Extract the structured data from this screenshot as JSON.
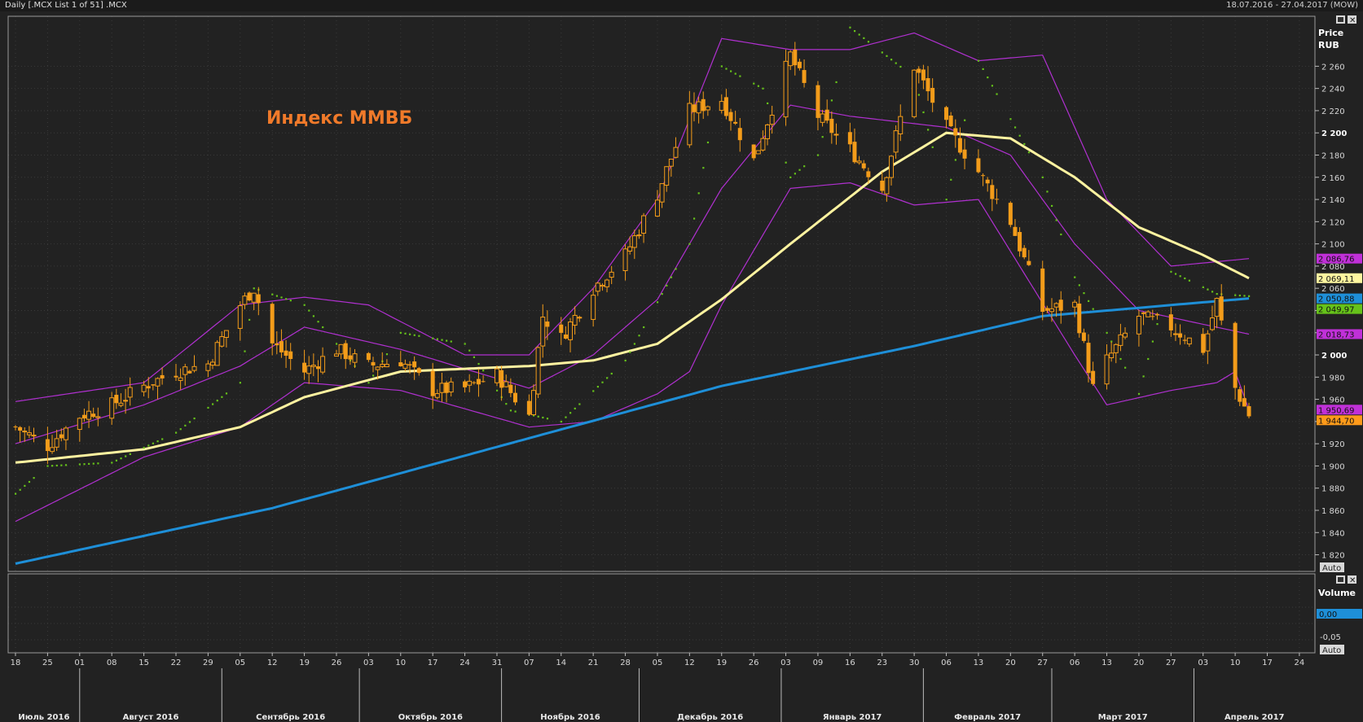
{
  "window": {
    "title": "Daily [.MCX List 1 of 51] .MCX",
    "date_range": "18.07.2016 - 27.04.2017 (MOW)",
    "auto_label": "Auto"
  },
  "price_panel": {
    "axis_title_1": "Price",
    "axis_title_2": "RUB"
  },
  "volume_panel": {
    "title": "Volume",
    "value_tag": "0,00",
    "tick": "-0,05"
  },
  "chart_data": {
    "type": "candlestick",
    "title": "Индекс ММВБ",
    "ylim": [
      1805,
      2305
    ],
    "y_ticks": [
      {
        "label": "1 820",
        "bold": false
      },
      {
        "label": "1 840",
        "bold": false
      },
      {
        "label": "1 860",
        "bold": false
      },
      {
        "label": "1 880",
        "bold": false
      },
      {
        "label": "1 900",
        "bold": false
      },
      {
        "label": "1 920",
        "bold": false
      },
      {
        "label": "1 940",
        "bold": false
      },
      {
        "label": "1 960",
        "bold": false
      },
      {
        "label": "1 980",
        "bold": false
      },
      {
        "label": "2 000",
        "bold": true
      },
      {
        "label": "2 020",
        "bold": false
      },
      {
        "label": "2 040",
        "bold": false
      },
      {
        "label": "2 060",
        "bold": false
      },
      {
        "label": "2 080",
        "bold": false
      },
      {
        "label": "2 100",
        "bold": false
      },
      {
        "label": "2 120",
        "bold": false
      },
      {
        "label": "2 140",
        "bold": false
      },
      {
        "label": "2 160",
        "bold": false
      },
      {
        "label": "2 180",
        "bold": false
      },
      {
        "label": "2 200",
        "bold": true
      },
      {
        "label": "2 220",
        "bold": false
      },
      {
        "label": "2 240",
        "bold": false
      },
      {
        "label": "2 260",
        "bold": false
      }
    ],
    "x_day_labels": [
      "18",
      "25",
      "01",
      "08",
      "15",
      "22",
      "29",
      "05",
      "12",
      "19",
      "26",
      "03",
      "10",
      "17",
      "24",
      "31",
      "07",
      "14",
      "21",
      "28",
      "05",
      "12",
      "19",
      "26",
      "03",
      "09",
      "16",
      "23",
      "30",
      "06",
      "13",
      "20",
      "27",
      "06",
      "13",
      "20",
      "27",
      "03",
      "10",
      "17",
      "24"
    ],
    "x_month_labels": [
      "Июль 2016",
      "Август 2016",
      "Сентябрь 2016",
      "Октябрь 2016",
      "Ноябрь 2016",
      "Декабрь 2016",
      "Январь 2017",
      "Февраль 2017",
      "Март 2017",
      "Апрель 2017"
    ],
    "close_keypoints": [
      {
        "date": "2016-07-18",
        "close": 1935
      },
      {
        "date": "2016-07-25",
        "close": 1918
      },
      {
        "date": "2016-08-01",
        "close": 1945
      },
      {
        "date": "2016-08-08",
        "close": 1955
      },
      {
        "date": "2016-08-15",
        "close": 1972
      },
      {
        "date": "2016-08-22",
        "close": 1985
      },
      {
        "date": "2016-08-29",
        "close": 1992
      },
      {
        "date": "2016-09-05",
        "close": 2045
      },
      {
        "date": "2016-09-08",
        "close": 2060
      },
      {
        "date": "2016-09-12",
        "close": 2010
      },
      {
        "date": "2016-09-19",
        "close": 1985
      },
      {
        "date": "2016-09-26",
        "close": 2005
      },
      {
        "date": "2016-10-03",
        "close": 1990
      },
      {
        "date": "2016-10-10",
        "close": 1995
      },
      {
        "date": "2016-10-17",
        "close": 1968
      },
      {
        "date": "2016-10-24",
        "close": 1970
      },
      {
        "date": "2016-10-31",
        "close": 1982
      },
      {
        "date": "2016-11-07",
        "close": 1945
      },
      {
        "date": "2016-11-10",
        "close": 2035
      },
      {
        "date": "2016-11-14",
        "close": 2015
      },
      {
        "date": "2016-11-21",
        "close": 2060
      },
      {
        "date": "2016-11-28",
        "close": 2090
      },
      {
        "date": "2016-12-05",
        "close": 2145
      },
      {
        "date": "2016-12-12",
        "close": 2220
      },
      {
        "date": "2016-12-19",
        "close": 2230
      },
      {
        "date": "2016-12-26",
        "close": 2175
      },
      {
        "date": "2017-01-03",
        "close": 2270
      },
      {
        "date": "2017-01-09",
        "close": 2215
      },
      {
        "date": "2017-01-16",
        "close": 2185
      },
      {
        "date": "2017-01-23",
        "close": 2150
      },
      {
        "date": "2017-01-30",
        "close": 2260
      },
      {
        "date": "2017-02-06",
        "close": 2205
      },
      {
        "date": "2017-02-13",
        "close": 2165
      },
      {
        "date": "2017-02-20",
        "close": 2120
      },
      {
        "date": "2017-02-27",
        "close": 2040
      },
      {
        "date": "2017-03-06",
        "close": 2045
      },
      {
        "date": "2017-03-10",
        "close": 1970
      },
      {
        "date": "2017-03-13",
        "close": 1995
      },
      {
        "date": "2017-03-20",
        "close": 2035
      },
      {
        "date": "2017-03-27",
        "close": 2025
      },
      {
        "date": "2017-04-03",
        "close": 2005
      },
      {
        "date": "2017-04-06",
        "close": 2048
      },
      {
        "date": "2017-04-10",
        "close": 1970
      },
      {
        "date": "2017-04-13",
        "close": 1945
      }
    ],
    "sma_yellow": [
      {
        "date": "2016-07-18",
        "value": 1903
      },
      {
        "date": "2016-08-15",
        "value": 1915
      },
      {
        "date": "2016-09-05",
        "value": 1935
      },
      {
        "date": "2016-09-19",
        "value": 1962
      },
      {
        "date": "2016-10-10",
        "value": 1985
      },
      {
        "date": "2016-11-07",
        "value": 1990
      },
      {
        "date": "2016-11-21",
        "value": 1995
      },
      {
        "date": "2016-12-05",
        "value": 2010
      },
      {
        "date": "2016-12-19",
        "value": 2050
      },
      {
        "date": "2017-01-03",
        "value": 2100
      },
      {
        "date": "2017-01-23",
        "value": 2165
      },
      {
        "date": "2017-02-06",
        "value": 2200
      },
      {
        "date": "2017-02-20",
        "value": 2195
      },
      {
        "date": "2017-03-06",
        "value": 2160
      },
      {
        "date": "2017-03-20",
        "value": 2115
      },
      {
        "date": "2017-04-03",
        "value": 2090
      },
      {
        "date": "2017-04-13",
        "value": 2069.11
      }
    ],
    "sma_blue": [
      {
        "date": "2016-07-18",
        "value": 1812
      },
      {
        "date": "2016-09-12",
        "value": 1862
      },
      {
        "date": "2016-11-07",
        "value": 1925
      },
      {
        "date": "2016-12-19",
        "value": 1972
      },
      {
        "date": "2017-01-30",
        "value": 2008
      },
      {
        "date": "2017-02-27",
        "value": 2035
      },
      {
        "date": "2017-04-13",
        "value": 2050.88
      }
    ],
    "bb_upper": [
      {
        "date": "2016-07-18",
        "value": 1958
      },
      {
        "date": "2016-08-15",
        "value": 1975
      },
      {
        "date": "2016-09-05",
        "value": 2045
      },
      {
        "date": "2016-09-19",
        "value": 2052
      },
      {
        "date": "2016-10-03",
        "value": 2045
      },
      {
        "date": "2016-10-24",
        "value": 2000
      },
      {
        "date": "2016-11-07",
        "value": 2000
      },
      {
        "date": "2016-11-21",
        "value": 2060
      },
      {
        "date": "2016-12-05",
        "value": 2140
      },
      {
        "date": "2016-12-19",
        "value": 2285
      },
      {
        "date": "2017-01-03",
        "value": 2275
      },
      {
        "date": "2017-01-16",
        "value": 2275
      },
      {
        "date": "2017-01-30",
        "value": 2290
      },
      {
        "date": "2017-02-13",
        "value": 2265
      },
      {
        "date": "2017-02-27",
        "value": 2270
      },
      {
        "date": "2017-03-13",
        "value": 2140
      },
      {
        "date": "2017-03-27",
        "value": 2080
      },
      {
        "date": "2017-04-13",
        "value": 2086.76
      }
    ],
    "bb_middle": [
      {
        "date": "2016-07-18",
        "value": 1920
      },
      {
        "date": "2016-08-15",
        "value": 1955
      },
      {
        "date": "2016-09-05",
        "value": 1990
      },
      {
        "date": "2016-09-19",
        "value": 2025
      },
      {
        "date": "2016-10-10",
        "value": 2005
      },
      {
        "date": "2016-11-07",
        "value": 1970
      },
      {
        "date": "2016-11-21",
        "value": 2000
      },
      {
        "date": "2016-12-05",
        "value": 2050
      },
      {
        "date": "2016-12-19",
        "value": 2150
      },
      {
        "date": "2017-01-03",
        "value": 2225
      },
      {
        "date": "2017-01-16",
        "value": 2215
      },
      {
        "date": "2017-02-06",
        "value": 2205
      },
      {
        "date": "2017-02-20",
        "value": 2180
      },
      {
        "date": "2017-03-06",
        "value": 2100
      },
      {
        "date": "2017-03-20",
        "value": 2040
      },
      {
        "date": "2017-04-13",
        "value": 2018.73
      }
    ],
    "bb_lower": [
      {
        "date": "2016-07-18",
        "value": 1850
      },
      {
        "date": "2016-08-15",
        "value": 1908
      },
      {
        "date": "2016-09-05",
        "value": 1935
      },
      {
        "date": "2016-09-19",
        "value": 1975
      },
      {
        "date": "2016-10-10",
        "value": 1968
      },
      {
        "date": "2016-11-07",
        "value": 1935
      },
      {
        "date": "2016-11-21",
        "value": 1940
      },
      {
        "date": "2016-12-05",
        "value": 1965
      },
      {
        "date": "2016-12-12",
        "value": 1985
      },
      {
        "date": "2016-12-19",
        "value": 2045
      },
      {
        "date": "2017-01-03",
        "value": 2150
      },
      {
        "date": "2017-01-16",
        "value": 2155
      },
      {
        "date": "2017-01-30",
        "value": 2135
      },
      {
        "date": "2017-02-13",
        "value": 2140
      },
      {
        "date": "2017-03-06",
        "value": 2000
      },
      {
        "date": "2017-03-13",
        "value": 1955
      },
      {
        "date": "2017-03-27",
        "value": 1968
      },
      {
        "date": "2017-04-06",
        "value": 1975
      },
      {
        "date": "2017-04-10",
        "value": 1985
      },
      {
        "date": "2017-04-13",
        "value": 1950.69
      }
    ],
    "psar": [
      {
        "date": "2016-07-18",
        "value": 1875
      },
      {
        "date": "2016-07-25",
        "value": 1900
      },
      {
        "date": "2016-08-08",
        "value": 1903
      },
      {
        "date": "2016-08-22",
        "value": 1930
      },
      {
        "date": "2016-09-05",
        "value": 1975
      },
      {
        "date": "2016-09-08",
        "value": 2060
      },
      {
        "date": "2016-09-19",
        "value": 2045
      },
      {
        "date": "2016-10-03",
        "value": 1975
      },
      {
        "date": "2016-10-10",
        "value": 2020
      },
      {
        "date": "2016-10-24",
        "value": 2010
      },
      {
        "date": "2016-11-03",
        "value": 1950
      },
      {
        "date": "2016-11-14",
        "value": 1940
      },
      {
        "date": "2016-11-28",
        "value": 1995
      },
      {
        "date": "2016-12-12",
        "value": 2100
      },
      {
        "date": "2016-12-19",
        "value": 2260
      },
      {
        "date": "2016-12-28",
        "value": 2240
      },
      {
        "date": "2017-01-03",
        "value": 2160
      },
      {
        "date": "2017-01-09",
        "value": 2180
      },
      {
        "date": "2017-01-16",
        "value": 2295
      },
      {
        "date": "2017-01-30",
        "value": 2250
      },
      {
        "date": "2017-02-06",
        "value": 2140
      },
      {
        "date": "2017-02-13",
        "value": 2265
      },
      {
        "date": "2017-02-27",
        "value": 2160
      },
      {
        "date": "2017-03-06",
        "value": 2070
      },
      {
        "date": "2017-03-13",
        "value": 2020
      },
      {
        "date": "2017-03-20",
        "value": 1965
      },
      {
        "date": "2017-03-27",
        "value": 2075
      },
      {
        "date": "2017-04-06",
        "value": 2055
      },
      {
        "date": "2017-04-13",
        "value": 2053
      }
    ],
    "tags": [
      {
        "label": "2 086,76",
        "value": 2086.76,
        "color": "#c030d8"
      },
      {
        "label": "2 069,11",
        "value": 2069.11,
        "color": "#fff7a0"
      },
      {
        "label": "2 050,88",
        "value": 2050.88,
        "color": "#1e8fd8"
      },
      {
        "label": "2 049,97",
        "value": 2049.97,
        "color": "#66c21a"
      },
      {
        "label": "2 018,73",
        "value": 2018.73,
        "color": "#c030d8"
      },
      {
        "label": "1 950,69",
        "value": 1950.69,
        "color": "#c030d8"
      },
      {
        "label": "1 944,70",
        "value": 1944.7,
        "color": "#ff9a1a"
      }
    ],
    "colors": {
      "candle": "#f39c1a",
      "sma_yellow": "#fff3a0",
      "sma_blue": "#1e8fd8",
      "bollinger": "#b030d0",
      "psar": "#66c21a",
      "grid": "#3a3a3a",
      "title": "#f07a2a"
    }
  }
}
